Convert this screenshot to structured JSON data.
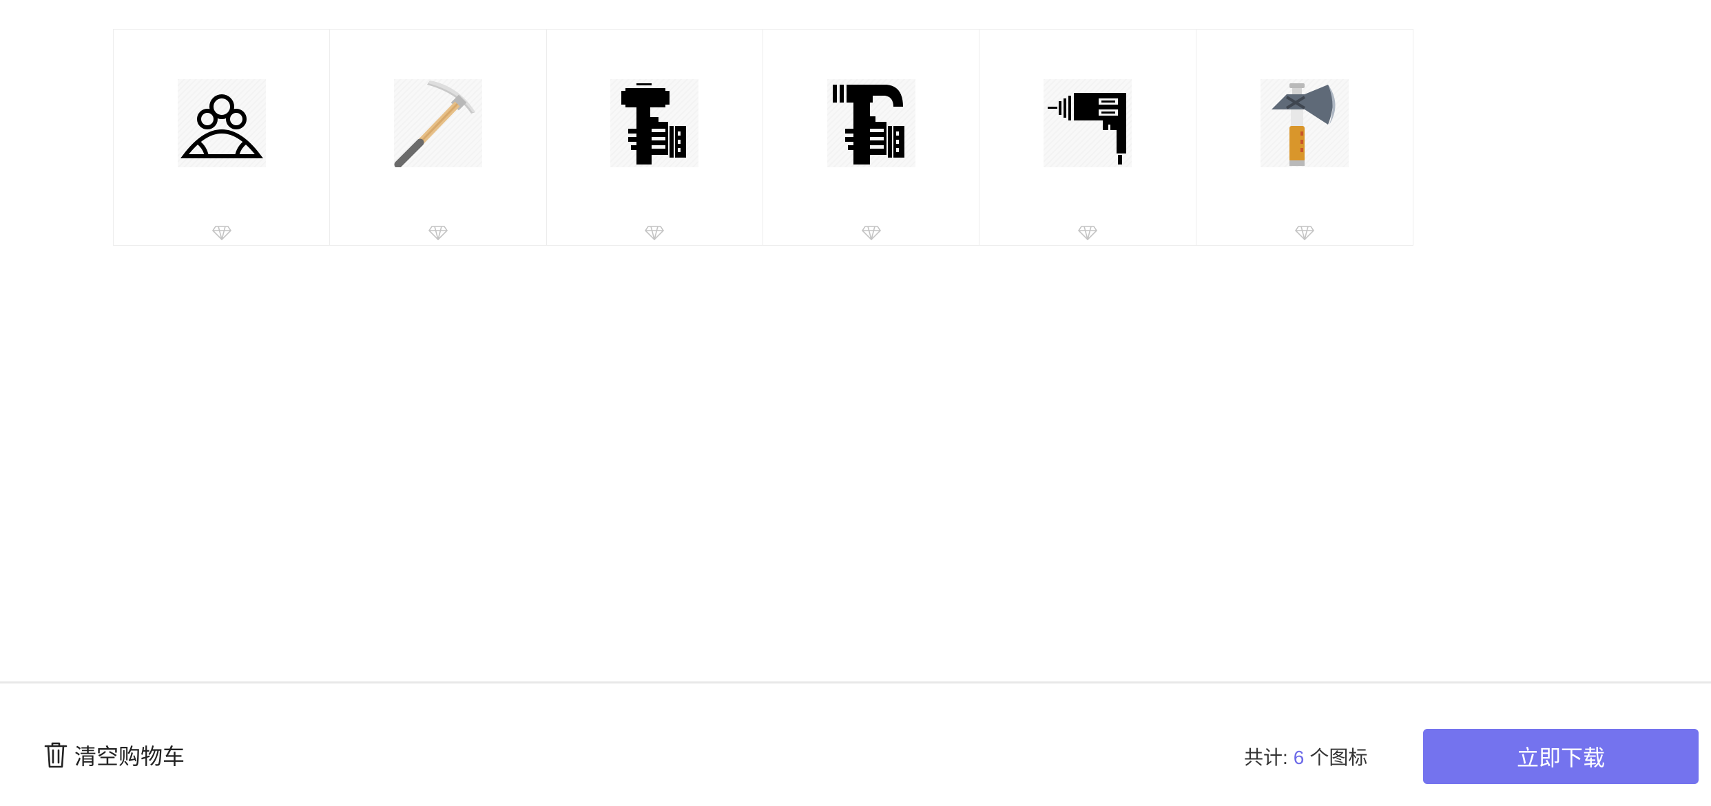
{
  "icons": [
    {
      "name": "group-of-people-icon",
      "premium_icon": "diamond-icon"
    },
    {
      "name": "pickaxe-icon",
      "premium_icon": "diamond-icon"
    },
    {
      "name": "hand-holding-hammer-icon",
      "premium_icon": "diamond-icon"
    },
    {
      "name": "hand-holding-claw-hammer-icon",
      "premium_icon": "diamond-icon"
    },
    {
      "name": "power-drill-icon",
      "premium_icon": "diamond-icon"
    },
    {
      "name": "axe-icon",
      "premium_icon": "diamond-icon"
    }
  ],
  "footer": {
    "clear_cart_label": "清空购物车",
    "clear_cart_icon": "trash-icon",
    "total_prefix": "共计:",
    "total_count": "6",
    "total_suffix": "个图标",
    "download_label": "立即下载"
  },
  "colors": {
    "accent": "#7473ee",
    "count_highlight": "#6c6ae8",
    "border": "#ededed"
  }
}
